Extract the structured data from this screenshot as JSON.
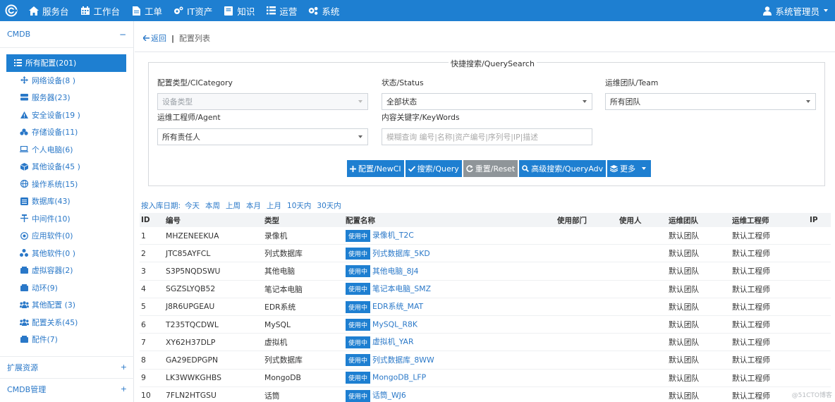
{
  "topbar": {
    "nav": [
      {
        "label": "服务台",
        "icon": "home-icon"
      },
      {
        "label": "工作台",
        "icon": "calendar-icon"
      },
      {
        "label": "工单",
        "icon": "file-icon"
      },
      {
        "label": "IT资产",
        "icon": "cogs-icon"
      },
      {
        "label": "知识",
        "icon": "book-icon"
      },
      {
        "label": "运营",
        "icon": "list-icon"
      },
      {
        "label": "系统",
        "icon": "gears-icon"
      }
    ],
    "user": "系统管理员"
  },
  "sidebar": {
    "section_cmdb": "CMDB",
    "section_cmdb_toggle": "−",
    "items": [
      {
        "label": "所有配置(201)",
        "icon": "list-icon"
      },
      {
        "label": "网络设备(8 )",
        "icon": "network-icon"
      },
      {
        "label": "服务器(23)",
        "icon": "server-icon"
      },
      {
        "label": "安全设备(19 )",
        "icon": "warning-icon"
      },
      {
        "label": "存储设备(11)",
        "icon": "storage-icon"
      },
      {
        "label": "个人电脑(6)",
        "icon": "laptop-icon"
      },
      {
        "label": "其他设备(45 )",
        "icon": "cube-icon"
      },
      {
        "label": "操作系统(15)",
        "icon": "globe-icon"
      },
      {
        "label": "数据库(43)",
        "icon": "database-icon"
      },
      {
        "label": "中间件(10)",
        "icon": "middleware-icon"
      },
      {
        "label": "应用软件(0)",
        "icon": "app-icon"
      },
      {
        "label": "其他软件(0 )",
        "icon": "sitemap-icon"
      },
      {
        "label": "虚拟容器(2)",
        "icon": "container-icon"
      },
      {
        "label": "动环(9)",
        "icon": "container-icon"
      },
      {
        "label": "其他配置 (3)",
        "icon": "group-icon"
      },
      {
        "label": "配置关系(45)",
        "icon": "group-icon"
      },
      {
        "label": "配件(7)",
        "icon": "container-icon"
      }
    ],
    "section_ext": "扩展资源",
    "section_ext_toggle": "+",
    "section_mgmt": "CMDB管理",
    "section_mgmt_toggle": "+"
  },
  "breadcrumb": {
    "back": "返回",
    "sep": "|",
    "current": "配置列表"
  },
  "search": {
    "title": "快捷搜索/QuerySearch",
    "category_label": "配置类型/CICategory",
    "category_placeholder": "设备类型",
    "status_label": "状态/Status",
    "status_value": "全部状态",
    "team_label": "运维团队/Team",
    "team_value": "所有团队",
    "agent_label": "运维工程师/Agent",
    "agent_value": "所有责任人",
    "keywords_label": "内容关键字/KeyWords",
    "keywords_placeholder": "模糊查询 编号|名称|资产编号|序列号|IP|描述",
    "buttons": {
      "new": "配置/NewCI",
      "query": "搜索/Query",
      "reset": "重置/Reset",
      "adv": "高级搜索/QueryAdv",
      "more": "更多"
    }
  },
  "datefilter": {
    "label": "按入库日期:",
    "links": [
      "今天",
      "本周",
      "上周",
      "本月",
      "上月",
      "10天内",
      "30天内"
    ]
  },
  "table": {
    "headers": [
      "ID",
      "编号",
      "类型",
      "配置名称",
      "使用部门",
      "使用人",
      "运维团队",
      "运维工程师",
      "IP"
    ],
    "badge": "使用中",
    "rows": [
      {
        "id": "1",
        "code": "MHZENEEKUA",
        "type": "录像机",
        "name": "录像机_T2C",
        "team": "默认团队",
        "eng": "默认工程师"
      },
      {
        "id": "2",
        "code": "JTC85AYFCL",
        "type": "列式数据库",
        "name": "列式数据库_5KD",
        "team": "默认团队",
        "eng": "默认工程师"
      },
      {
        "id": "3",
        "code": "S3P5NQDSWU",
        "type": "其他电脑",
        "name": "其他电脑_8J4",
        "team": "默认团队",
        "eng": "默认工程师"
      },
      {
        "id": "4",
        "code": "SGZSLYQB52",
        "type": "笔记本电脑",
        "name": "笔记本电脑_SMZ",
        "team": "默认团队",
        "eng": "默认工程师"
      },
      {
        "id": "5",
        "code": "J8R6UPGEAU",
        "type": "EDR系统",
        "name": "EDR系统_MAT",
        "team": "默认团队",
        "eng": "默认工程师"
      },
      {
        "id": "6",
        "code": "T235TQCDWL",
        "type": "MySQL",
        "name": "MySQL_R8K",
        "team": "默认团队",
        "eng": "默认工程师"
      },
      {
        "id": "7",
        "code": "XY62H37DLP",
        "type": "虚拟机",
        "name": "虚拟机_YAR",
        "team": "默认团队",
        "eng": "默认工程师"
      },
      {
        "id": "8",
        "code": "GA29EDPGPN",
        "type": "列式数据库",
        "name": "列式数据库_8WW",
        "team": "默认团队",
        "eng": "默认工程师"
      },
      {
        "id": "9",
        "code": "LK3WWKGHBS",
        "type": "MongoDB",
        "name": "MongoDB_LFP",
        "team": "默认团队",
        "eng": "默认工程师"
      },
      {
        "id": "10",
        "code": "7FLN2HTGSU",
        "type": "话筒",
        "name": "话筒_WJ6",
        "team": "默认团队",
        "eng": "默认工程师"
      }
    ]
  },
  "watermark": "@51CTO博客"
}
